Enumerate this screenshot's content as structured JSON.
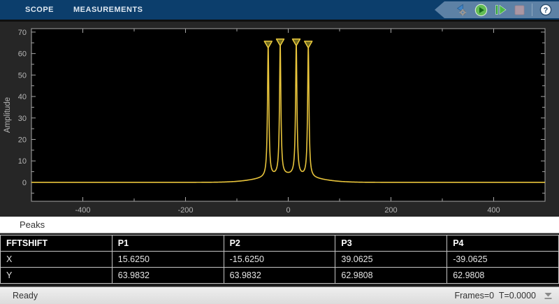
{
  "tabs": [
    {
      "label": "SCOPE"
    },
    {
      "label": "MEASUREMENTS"
    }
  ],
  "toolbar": {
    "step_back_label": "Step back",
    "run_label": "Run",
    "step_forward_label": "Step forward",
    "stop_label": "Stop",
    "help_label": "?"
  },
  "chart_data": {
    "type": "line",
    "title": "",
    "xlabel": "",
    "ylabel": "Amplitude",
    "xlim": [
      -500,
      500
    ],
    "ylim": [
      -8.8,
      71.6
    ],
    "x_ticks": [
      -400,
      -200,
      0,
      200,
      400
    ],
    "x_minor_step": 100,
    "y_ticks": [
      0,
      10,
      20,
      30,
      40,
      50,
      60,
      70
    ],
    "y_minor_step": 5,
    "grid": "off",
    "plot_bg": "#000000",
    "figure_bg": "#262626",
    "axis_color": "#a6a6a6",
    "label_color": "#b5b5b5",
    "line_color": "#e9c53c",
    "marker": {
      "shape": "triangle-down",
      "fill": "#6e691e",
      "stroke": "#eccb3f"
    },
    "peaks": [
      {
        "name": "P1",
        "x": 15.625,
        "y": 63.9832
      },
      {
        "name": "P2",
        "x": -15.625,
        "y": 63.9832
      },
      {
        "name": "P3",
        "x": 39.0625,
        "y": 62.9808
      },
      {
        "name": "P4",
        "x": -39.0625,
        "y": 62.9808
      }
    ],
    "profile": {
      "narrow_gamma": 1.6,
      "broad_amp": 3.2,
      "broad_sigma": 70
    }
  },
  "peaks_panel": {
    "title": "Peaks",
    "table": {
      "columns": [
        "FFTSHIFT",
        "P1",
        "P2",
        "P3",
        "P4"
      ],
      "rows": [
        {
          "label": "X",
          "values": [
            "15.6250",
            "-15.6250",
            "39.0625",
            "-39.0625"
          ]
        },
        {
          "label": "Y",
          "values": [
            "63.9832",
            "63.9832",
            "62.9808",
            "62.9808"
          ]
        }
      ]
    }
  },
  "statusbar": {
    "ready": "Ready",
    "frames_time": "Frames=0  T=0.0000"
  }
}
